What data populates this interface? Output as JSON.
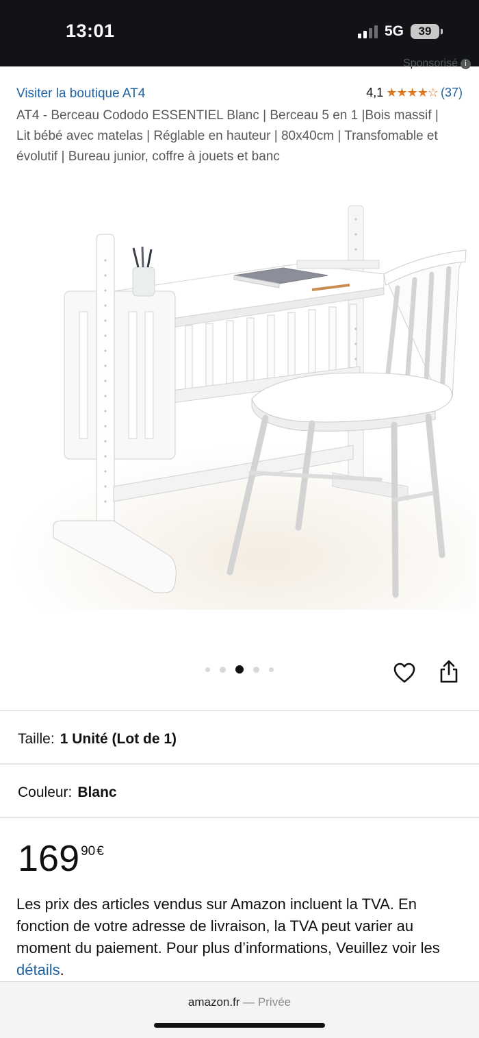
{
  "status_bar": {
    "time": "13:01",
    "network": "5G",
    "battery": "39"
  },
  "sponsored_label": "Sponsorisé",
  "product": {
    "store_link": "Visiter la boutique AT4",
    "rating_value": "4,1",
    "stars_display": "★★★★☆",
    "stars_rating": 4.1,
    "review_count": "(37)",
    "title": "AT4 - Berceau Cododo ESSENTIEL Blanc | Berceau 5 en 1 |Bois massif | Lit bébé avec matelas | Réglable en hauteur | 80x40cm | Transfomable et évolutif | Bureau junior, coffre à jouets et banc"
  },
  "carousel": {
    "dot_count": 5,
    "active_index": 2
  },
  "variations": {
    "size_label": "Taille:",
    "size_value": "1 Unité (Lot de 1)",
    "color_label": "Couleur:",
    "color_value": "Blanc"
  },
  "price": {
    "whole": "169",
    "fraction": "90",
    "currency": "€"
  },
  "vat": {
    "text": "Les prix des articles vendus sur Amazon incluent la TVA. En fonction de votre adresse de livraison, la TVA peut varier au moment du paiement. Pour plus d’informations, Veuillez voir les ",
    "link": "détails",
    "end": "."
  },
  "browser": {
    "domain": "amazon.fr",
    "mode": "— Privée"
  },
  "colors": {
    "link": "#2162a1",
    "star": "#de7921",
    "status_bar": "#111316"
  }
}
